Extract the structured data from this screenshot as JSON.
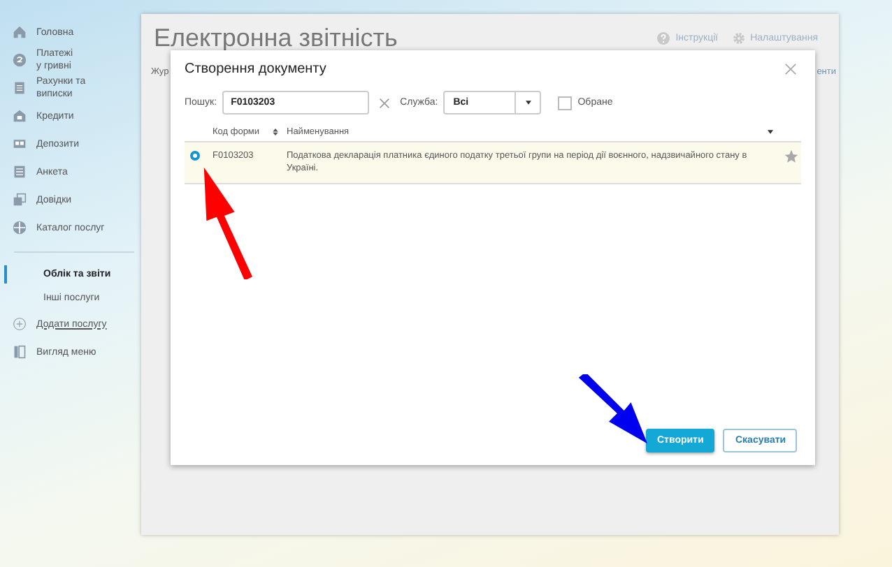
{
  "sidebar": {
    "items": [
      {
        "label": "Головна",
        "kind": "nav",
        "selected": false
      },
      {
        "label": "Платежі\nу гривні",
        "kind": "nav",
        "selected": false
      },
      {
        "label": "Рахунки та\nвиписки",
        "kind": "nav",
        "selected": false
      },
      {
        "label": "Кредити",
        "kind": "nav",
        "selected": false
      },
      {
        "label": "Депозити",
        "kind": "nav",
        "selected": false
      },
      {
        "label": "Анкета",
        "kind": "nav",
        "selected": false
      },
      {
        "label": "Довідки",
        "kind": "nav",
        "selected": false
      },
      {
        "label": "Каталог послуг",
        "kind": "nav",
        "selected": false
      },
      {
        "label": "Облік та звіти",
        "kind": "sub",
        "selected": true
      },
      {
        "label": "Інші послуги",
        "kind": "sub",
        "selected": false
      },
      {
        "label": "Додати послугу",
        "kind": "action",
        "selected": false
      },
      {
        "label": "Вигляд меню",
        "kind": "nav",
        "selected": false
      }
    ]
  },
  "page": {
    "title": "Електронна звітність",
    "links": [
      "Інструкції",
      "Налаштування"
    ],
    "subtitle_fragment": "Жур",
    "link_fragment": "енти"
  },
  "dialog": {
    "title": "Створення документу",
    "search": {
      "label": "Пошук:",
      "value": "F0103203"
    },
    "service": {
      "label": "Служба:",
      "value": "Всі"
    },
    "favorites": {
      "label": "Обране",
      "checked": false
    },
    "table": {
      "columns": [
        "Код форми",
        "Найменування"
      ],
      "rows": [
        {
          "code": "F0103203",
          "name": "Податкова декларація платника єдиного податку третьої групи на період дії воєнного, надзвичайного стану в Україні.",
          "selected": true,
          "favorite": false
        }
      ]
    },
    "buttons": [
      {
        "label": "Створити",
        "kind": "primary"
      },
      {
        "label": "Скасувати",
        "kind": "secondary"
      }
    ]
  }
}
